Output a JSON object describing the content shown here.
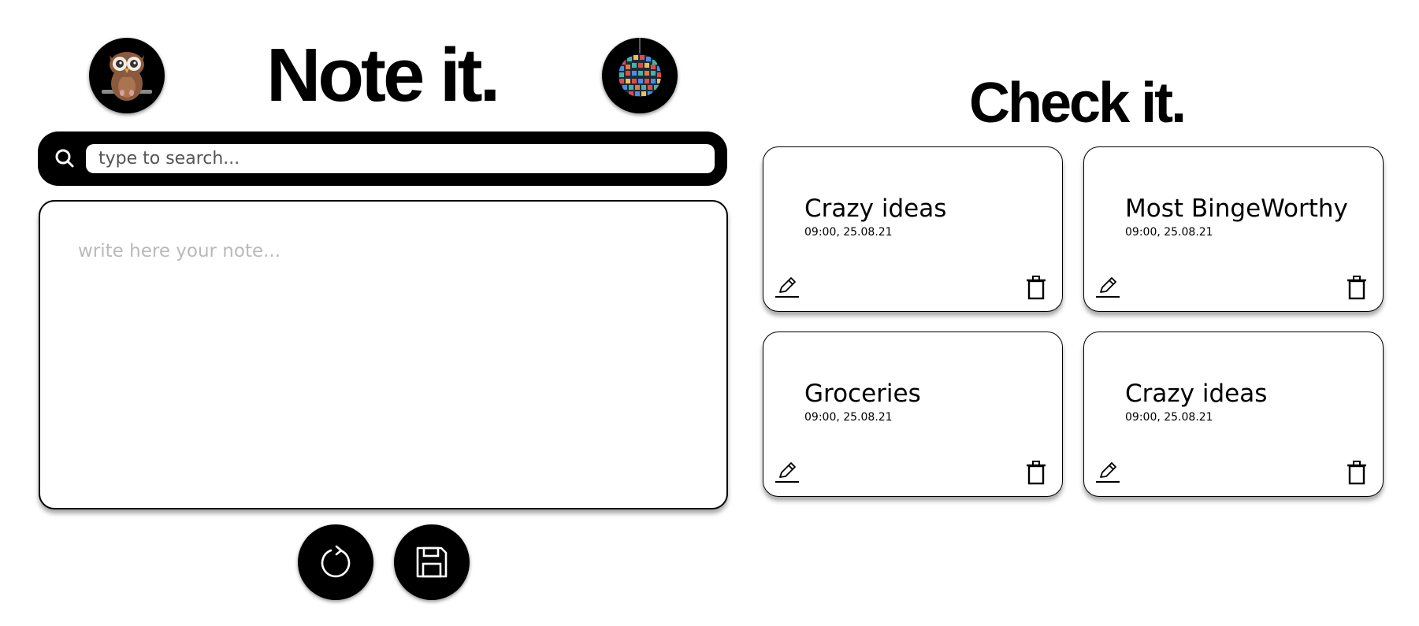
{
  "app": {
    "note_title": "Note it.",
    "check_title": "Check it."
  },
  "avatars": {
    "left_icon": "owl-icon",
    "right_icon": "disco-ball-icon"
  },
  "search": {
    "icon": "search-icon",
    "placeholder": "type to search...",
    "value": ""
  },
  "editor": {
    "placeholder": "write here your note...",
    "value": ""
  },
  "actions": {
    "refresh_icon": "refresh-icon",
    "save_icon": "save-icon"
  },
  "notes": [
    {
      "title": "Crazy ideas",
      "timestamp": "09:00, 25.08.21",
      "edit_icon": "pencil-icon",
      "delete_icon": "trash-icon"
    },
    {
      "title": "Most BingeWorthy",
      "timestamp": "09:00, 25.08.21",
      "edit_icon": "pencil-icon",
      "delete_icon": "trash-icon"
    },
    {
      "title": "Groceries",
      "timestamp": "09:00, 25.08.21",
      "edit_icon": "pencil-icon",
      "delete_icon": "trash-icon"
    },
    {
      "title": "Crazy ideas",
      "timestamp": "09:00, 25.08.21",
      "edit_icon": "pencil-icon",
      "delete_icon": "trash-icon"
    }
  ],
  "colors": {
    "primary": "#000000",
    "background": "#ffffff",
    "placeholder": "#b9b9b9"
  }
}
